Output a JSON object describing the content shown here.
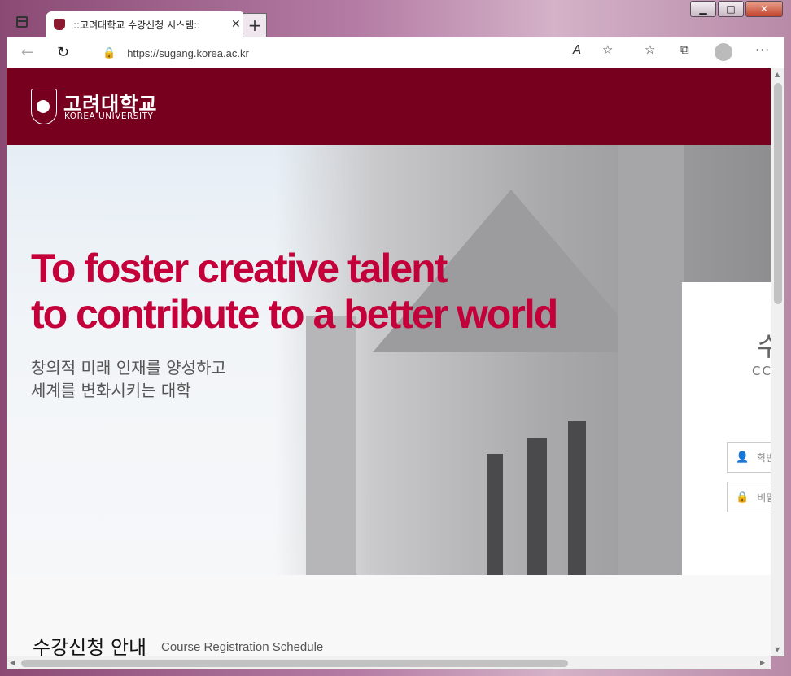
{
  "window": {
    "controls": {
      "minimize": "▁",
      "maximize": "□",
      "close": "✕"
    }
  },
  "browser": {
    "tab": {
      "title": "::고려대학교 수강신청 시스템::",
      "close": "✕"
    },
    "new_tab": "+",
    "back": "←",
    "reload": "↻",
    "url": "https://sugang.korea.ac.kr",
    "lock": "🔒",
    "read_aloud": "A",
    "favorite": "☆",
    "favorites": "☆",
    "collections": "⧉",
    "more": "···"
  },
  "site": {
    "logo_kr": "고려대학교",
    "logo_en": "KOREA UNIVERSITY",
    "hero": {
      "title_line1": "To foster creative talent",
      "title_line2": "to contribute  to a better world",
      "sub_line1": "창의적 미래 인재를 양성하고",
      "sub_line2": "세계를 변화시키는 대학"
    },
    "login": {
      "heading": "수",
      "sub": "CC",
      "id_placeholder": "학번",
      "pw_placeholder": "비밀"
    },
    "section": {
      "title_kr": "수강신청 안내",
      "title_en": "Course Registration Schedule"
    }
  },
  "colors": {
    "brand": "#77001f",
    "hero_text": "#c4003a"
  }
}
